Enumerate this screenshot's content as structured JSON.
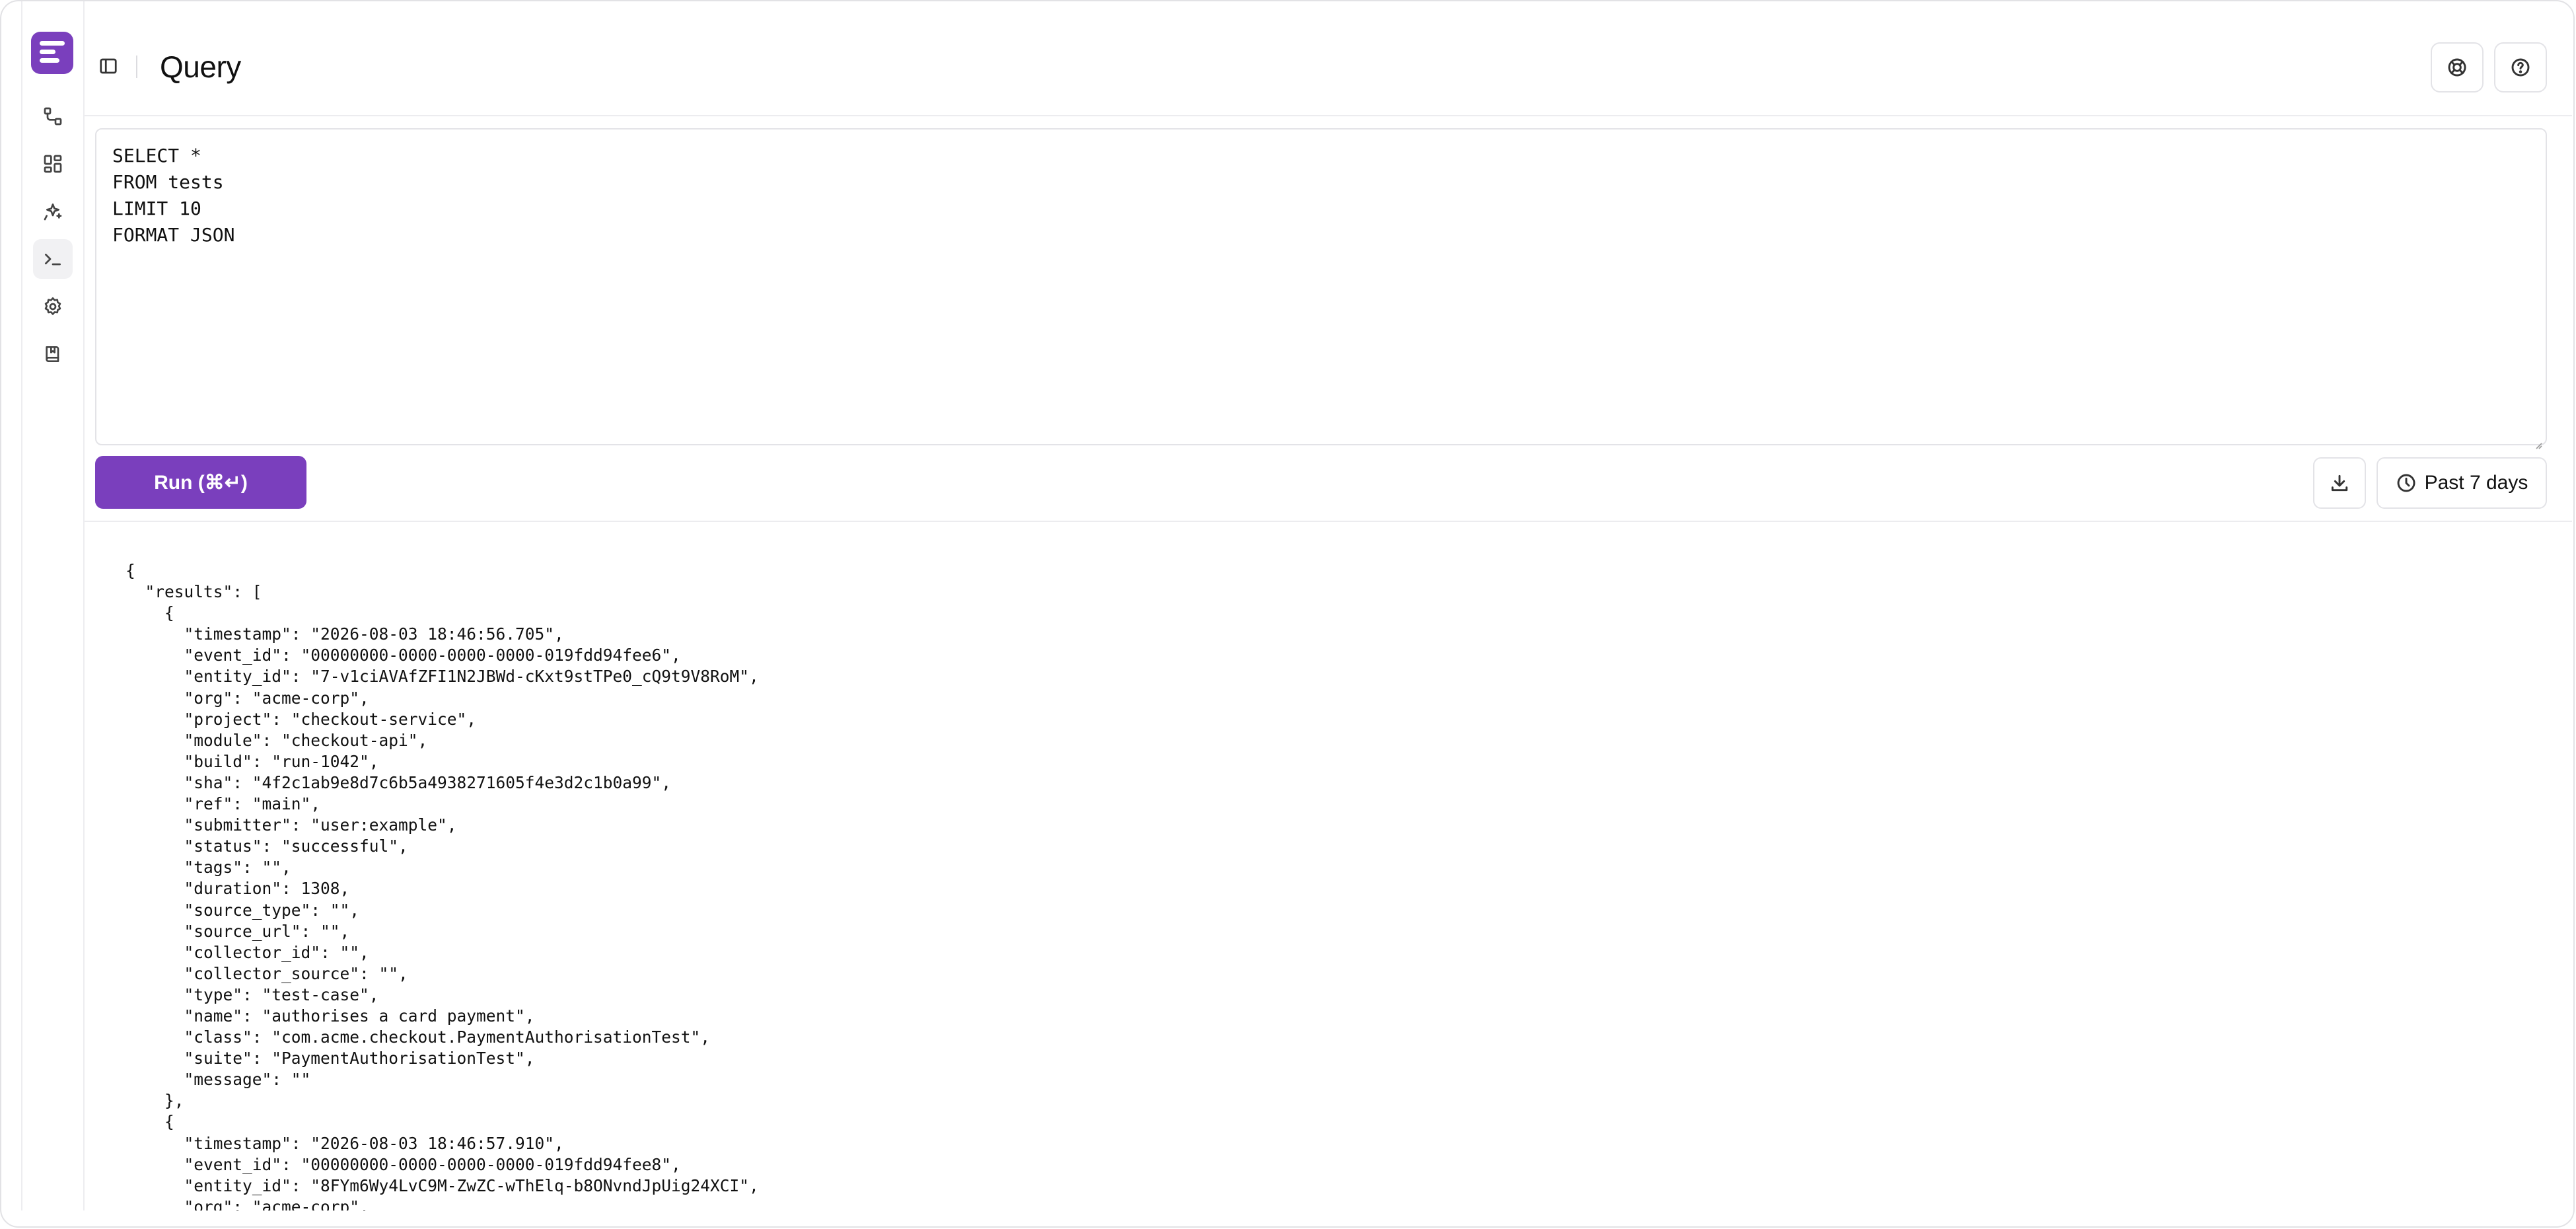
{
  "sidebar": {
    "logo": "logo-icon",
    "items": [
      {
        "name": "pipelines",
        "icon": "workflow-icon"
      },
      {
        "name": "dashboards",
        "icon": "dashboard-icon"
      },
      {
        "name": "insights",
        "icon": "sparkles-icon"
      },
      {
        "name": "query",
        "icon": "terminal-icon",
        "active": true
      },
      {
        "name": "settings",
        "icon": "gear-icon"
      },
      {
        "name": "docs",
        "icon": "book-icon"
      }
    ]
  },
  "header": {
    "title": "Query",
    "icons": [
      "support-icon",
      "help-icon"
    ]
  },
  "editor": {
    "lines": [
      "SELECT *",
      "FROM tests",
      "LIMIT 10",
      "FORMAT JSON"
    ]
  },
  "toolbar": {
    "run_label": "Run (⌘↵)",
    "time_range": "Past 7 days"
  },
  "results": {
    "lines": [
      "{",
      "  \"results\": [",
      "    {",
      "      \"timestamp\": \"2026-08-03 18:46:56.705\",",
      "      \"event_id\": \"00000000-0000-0000-0000-019fdd94fee6\",",
      "      \"entity_id\": \"7-v1ciAVAfZFI1N2JBWd-cKxt9stTPe0_cQ9t9V8RoM\",",
      "      \"org\": \"acme-corp\",",
      "      \"project\": \"checkout-service\",",
      "      \"module\": \"checkout-api\",",
      "      \"build\": \"run-1042\",",
      "      \"sha\": \"4f2c1ab9e8d7c6b5a4938271605f4e3d2c1b0a99\",",
      "      \"ref\": \"main\",",
      "      \"submitter\": \"user:example\",",
      "      \"status\": \"successful\",",
      "      \"tags\": \"\",",
      "      \"duration\": 1308,",
      "      \"source_type\": \"\",",
      "      \"source_url\": \"\",",
      "      \"collector_id\": \"\",",
      "      \"collector_source\": \"\",",
      "      \"type\": \"test-case\",",
      "      \"name\": \"authorises a card payment\",",
      "      \"class\": \"com.acme.checkout.PaymentAuthorisationTest\",",
      "      \"suite\": \"PaymentAuthorisationTest\",",
      "      \"message\": \"\"",
      "    },",
      "    {",
      "      \"timestamp\": \"2026-08-03 18:46:57.910\",",
      "      \"event_id\": \"00000000-0000-0000-0000-019fdd94fee8\",",
      "      \"entity_id\": \"8FYm6Wy4LvC9M-ZwZC-wThElq-b8ONvndJpUig24XCI\",",
      "      \"org\": \"acme-corp\","
    ]
  }
}
